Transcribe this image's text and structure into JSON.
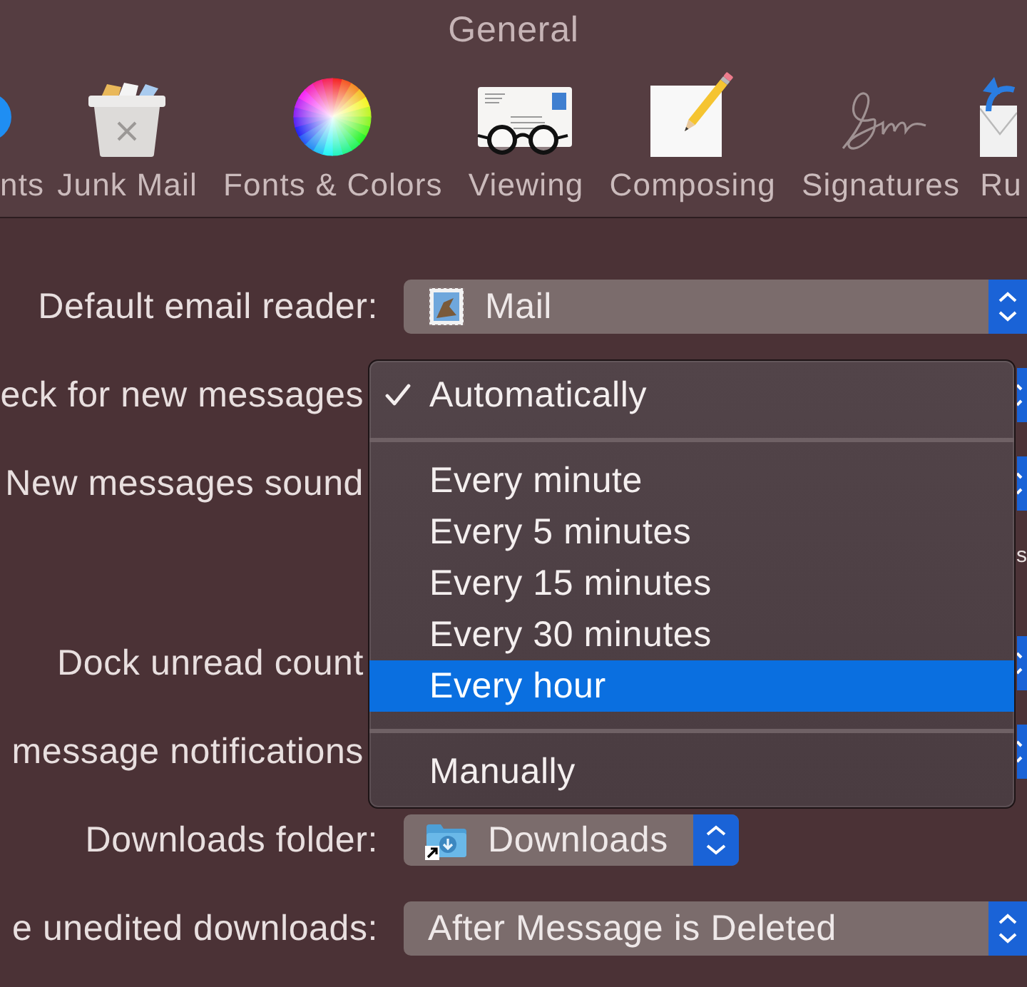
{
  "window": {
    "title": "General"
  },
  "toolbar": [
    {
      "label": "nts"
    },
    {
      "label": "Junk Mail"
    },
    {
      "label": "Fonts & Colors"
    },
    {
      "label": "Viewing"
    },
    {
      "label": "Composing"
    },
    {
      "label": "Signatures"
    },
    {
      "label": "Ru"
    }
  ],
  "form": {
    "rows": [
      {
        "kind": "popup",
        "label": "Default email reader:",
        "value": "Mail"
      },
      {
        "kind": "covered",
        "label": "eck for new messages"
      },
      {
        "kind": "covered",
        "label": "New messages sound"
      },
      {
        "kind": "fragment",
        "text": "s"
      },
      {
        "kind": "covered",
        "label": "Dock unread count"
      },
      {
        "kind": "covered",
        "label": "message notifications"
      },
      {
        "kind": "popup-compact",
        "label": "Downloads folder:",
        "value": "Downloads"
      },
      {
        "kind": "popup",
        "label": "e unedited downloads:",
        "value": "After Message is Deleted"
      }
    ]
  },
  "menu": {
    "sections": [
      {
        "items": [
          {
            "label": "Automatically",
            "checked": true,
            "selected": false
          }
        ]
      },
      {
        "items": [
          {
            "label": "Every minute",
            "checked": false,
            "selected": false
          },
          {
            "label": "Every 5 minutes",
            "checked": false,
            "selected": false
          },
          {
            "label": "Every 15 minutes",
            "checked": false,
            "selected": false
          },
          {
            "label": "Every 30 minutes",
            "checked": false,
            "selected": false
          },
          {
            "label": "Every hour",
            "checked": false,
            "selected": true
          }
        ]
      },
      {
        "items": [
          {
            "label": "Manually",
            "checked": false,
            "selected": false
          }
        ]
      }
    ]
  }
}
